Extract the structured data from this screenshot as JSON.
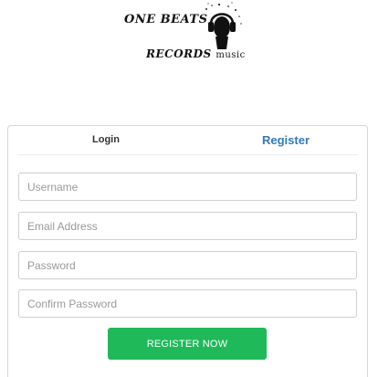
{
  "logo": {
    "line1": "ONE BEATS",
    "line2": "RECORDS",
    "line2_small": "music",
    "icon": "headphone-figure-icon"
  },
  "tabs": {
    "login": "Login",
    "register": "Register"
  },
  "form": {
    "username_placeholder": "Username",
    "email_placeholder": "Email Address",
    "password_placeholder": "Password",
    "confirm_placeholder": "Confirm Password",
    "submit_label": "REGISTER NOW"
  },
  "colors": {
    "accent_tab": "#337ab7",
    "button": "#1fb95a"
  }
}
